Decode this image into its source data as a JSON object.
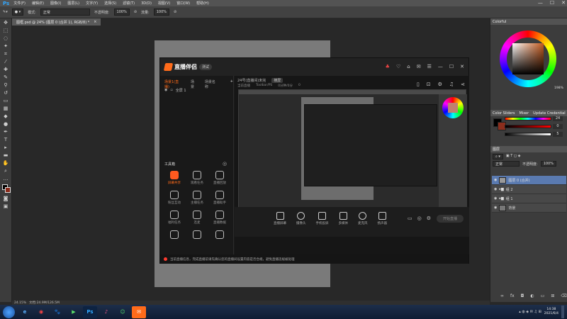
{
  "app": {
    "logo": "Ps",
    "menu": [
      "文件(F)",
      "编辑(E)",
      "图像(I)",
      "图层(L)",
      "文字(Y)",
      "选择(S)",
      "滤镜(T)",
      "3D(D)",
      "视图(V)",
      "窗口(W)",
      "帮助(H)"
    ]
  },
  "window_controls": [
    "—",
    "☐",
    "✕"
  ],
  "options_bar": {
    "mode_label": "模式:",
    "mode_value": "正常",
    "opacity_label": "不透明度:",
    "opacity_value": "100%",
    "flow_label": "流量:",
    "flow_value": "100%"
  },
  "document_tab": {
    "title": "图框.psd @ 24% (图层 0 (合并 1), RGB/8) *",
    "close": "×"
  },
  "live_app": {
    "brand": "直播伴侣",
    "version_badge": "测试",
    "scene_tabs": [
      "场景1(直播)",
      "场景",
      "场景名称"
    ],
    "scene_item": "全屏 1",
    "tools_title": "工具箱",
    "tools": [
      {
        "label": "屏幕共享",
        "hot": true
      },
      {
        "label": "观看任务",
        "hot": false
      },
      {
        "label": "直播回放",
        "hot": false
      },
      {
        "label": "粉丝互动",
        "hot": false
      },
      {
        "label": "主播任务",
        "hot": false
      },
      {
        "label": "直播助手",
        "hot": false
      },
      {
        "label": "福利任务",
        "hot": false
      },
      {
        "label": "连麦",
        "hot": false
      },
      {
        "label": "直播数据",
        "hot": false
      },
      {
        "label": "",
        "hot": false
      },
      {
        "label": "",
        "hot": false
      },
      {
        "label": "",
        "hot": false
      }
    ],
    "preview_title": "24号(直播间)未完",
    "preview_tag": "横屏",
    "preview_meta": [
      "当前直播",
      "Toolbar/PS",
      "0分钟/0分",
      "0"
    ],
    "bottom_buttons": [
      "直播屏幕",
      "摄像头",
      "手机投屏",
      "多媒体",
      "麦克风",
      "扬声器"
    ],
    "go_live": "开始直播",
    "status_text": "当前直播信息，完成直播前请先确认您的直播间设置内容是否合规，避免直播违规被处理"
  },
  "right_panel": {
    "color_tab": "Colorful",
    "wheel_readout": "198%",
    "slider_tabs": [
      "Color Sliders",
      "Mixer",
      "Update Credential"
    ],
    "slider_values": [
      "24",
      "0",
      "5"
    ],
    "layers_tab": "图层",
    "blend": "正常",
    "opacity_label": "不透明度:",
    "opacity": "100%",
    "layers": [
      {
        "name": "图层 0 (合并)",
        "selected": true
      },
      {
        "name": "组 2",
        "selected": false
      },
      {
        "name": "组 1",
        "selected": false
      },
      {
        "name": "背景",
        "selected": false
      }
    ]
  },
  "ps_status": {
    "zoom": "24.15%",
    "doc": "文档:24.9M/126.5M"
  },
  "taskbar": {
    "apps": [
      "e",
      "◉",
      "🐾",
      "▶",
      "Ps",
      "♪",
      "☺",
      "✉"
    ],
    "time": "14:38",
    "date": "2021/6/4"
  }
}
